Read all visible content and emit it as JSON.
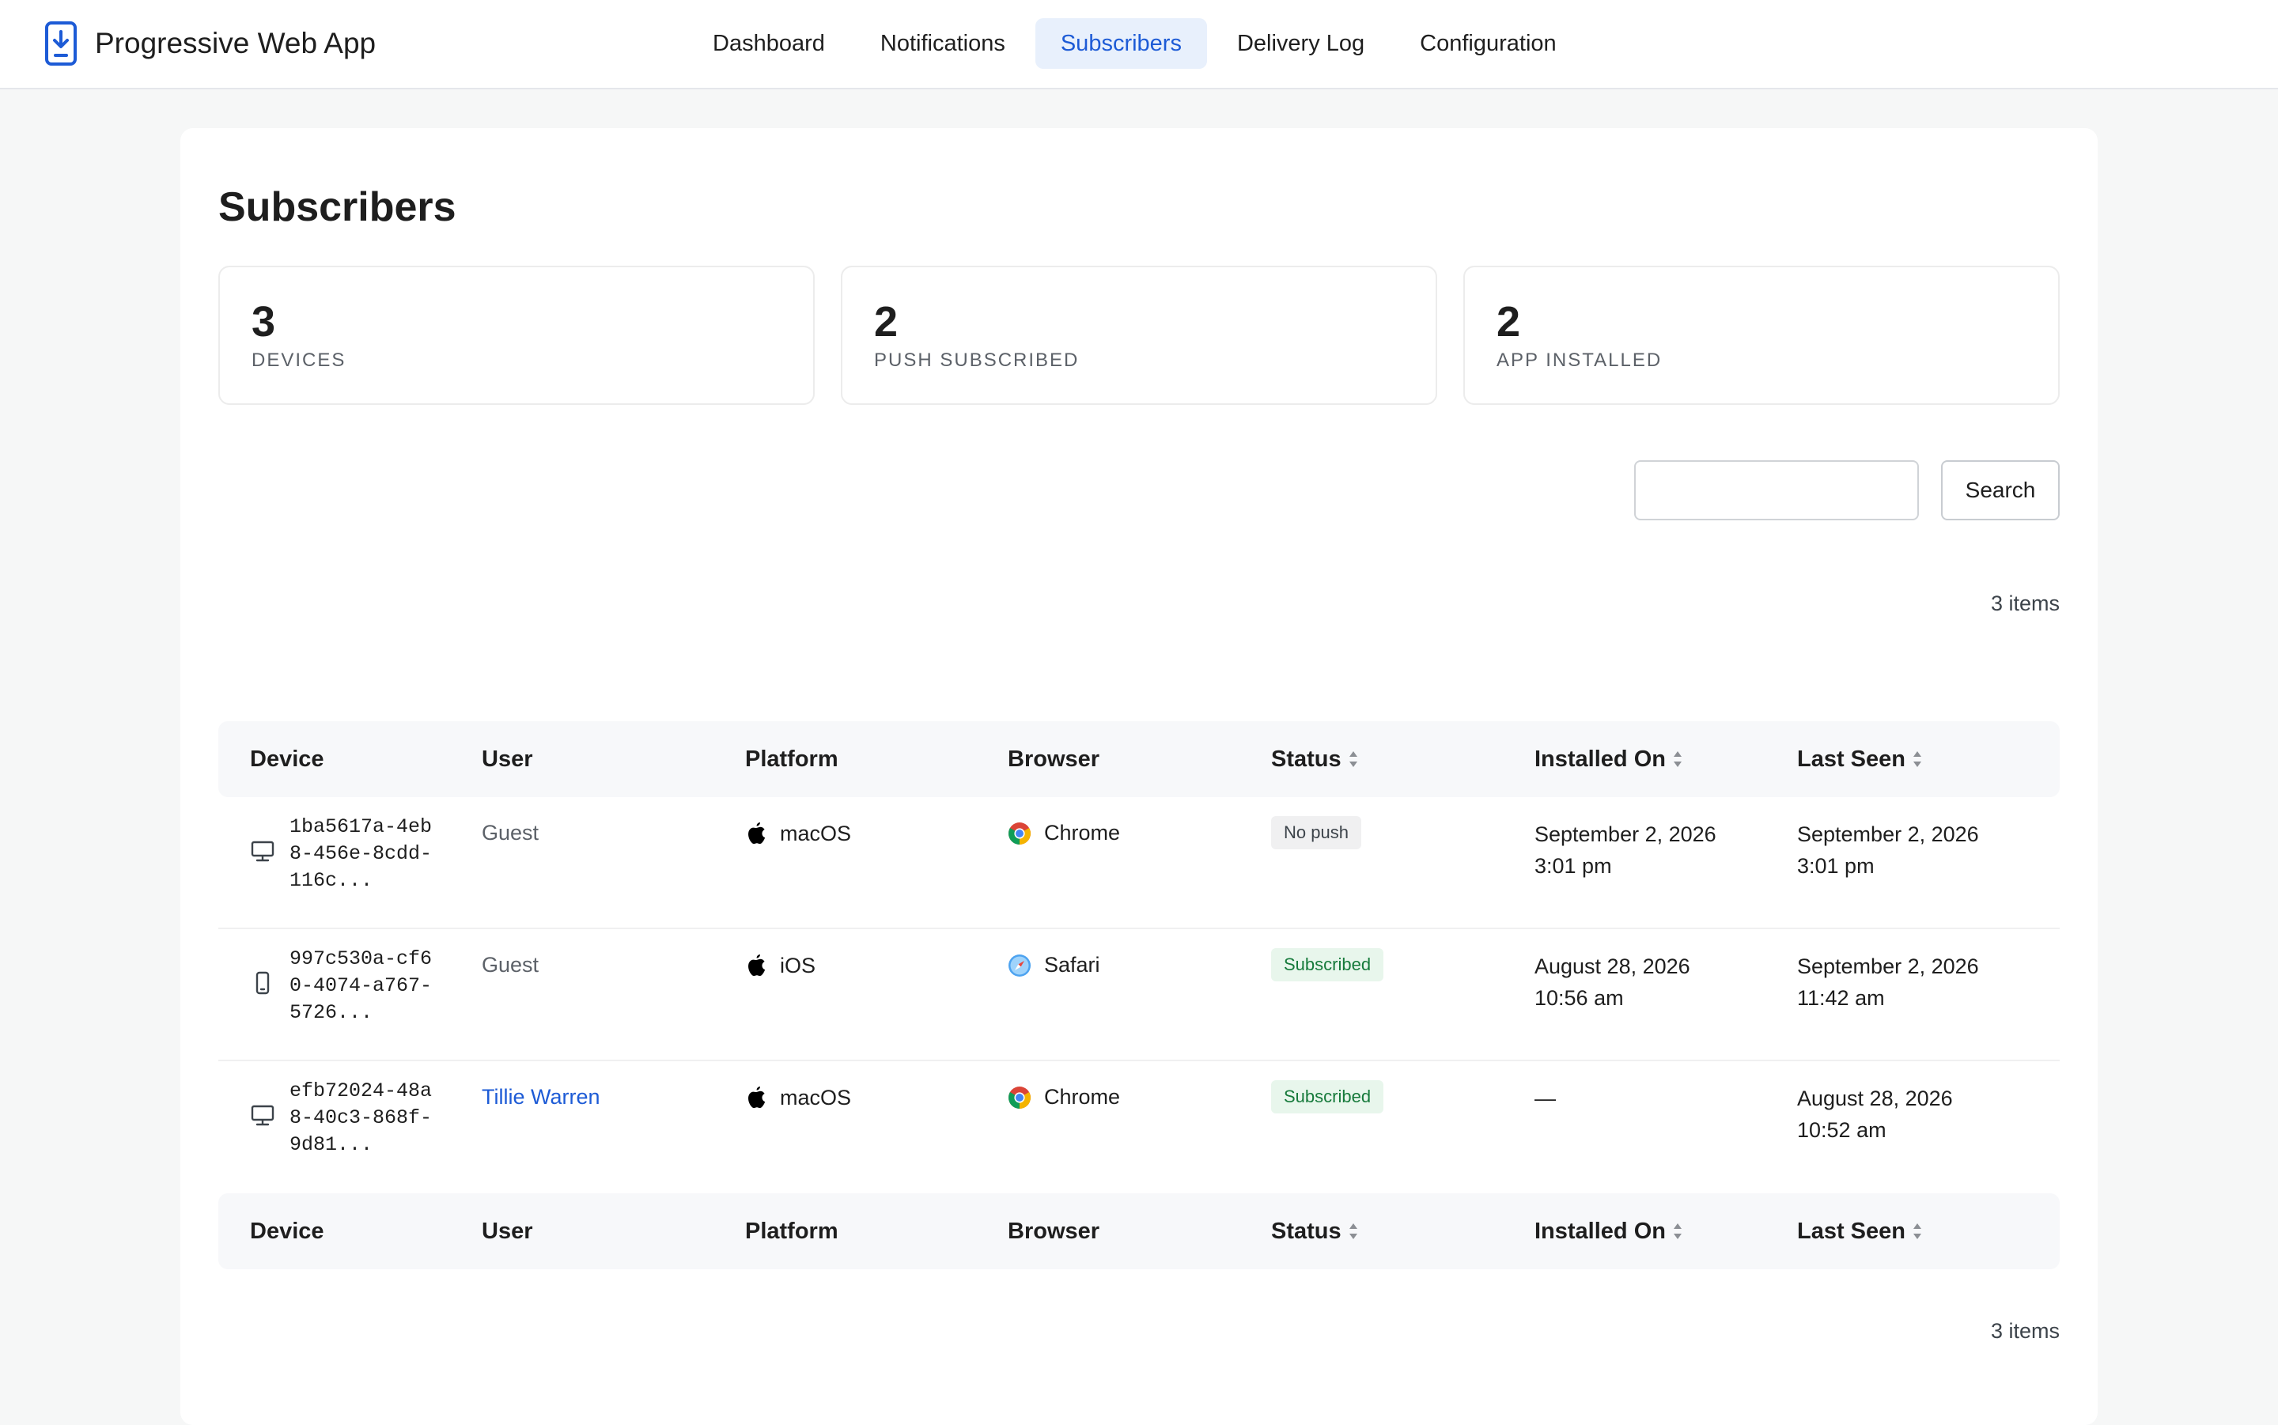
{
  "app": {
    "title": "Progressive Web App"
  },
  "nav": {
    "tabs": [
      {
        "label": "Dashboard",
        "active": false
      },
      {
        "label": "Notifications",
        "active": false
      },
      {
        "label": "Subscribers",
        "active": true
      },
      {
        "label": "Delivery Log",
        "active": false
      },
      {
        "label": "Configuration",
        "active": false
      }
    ]
  },
  "page": {
    "title": "Subscribers"
  },
  "stats": [
    {
      "value": "3",
      "label": "DEVICES"
    },
    {
      "value": "2",
      "label": "PUSH SUBSCRIBED"
    },
    {
      "value": "2",
      "label": "APP INSTALLED"
    }
  ],
  "search": {
    "value": "",
    "button_label": "Search"
  },
  "items_count": "3 items",
  "table": {
    "headers": [
      "Device",
      "User",
      "Platform",
      "Browser",
      "Status",
      "Installed On",
      "Last Seen"
    ],
    "rows": [
      {
        "device_icon": "desktop-icon",
        "device_id": "1ba5617a-4eb8-456e-8cdd-116c...",
        "user": "Guest",
        "user_is_link": false,
        "platform_icon": "apple-icon",
        "platform": "macOS",
        "browser_icon": "chrome-icon",
        "browser": "Chrome",
        "status": "No push",
        "installed_date": "September 2, 2026",
        "installed_time": "3:01 pm",
        "last_date": "September 2, 2026",
        "last_time": "3:01 pm"
      },
      {
        "device_icon": "mobile-icon",
        "device_id": "997c530a-cf60-4074-a767-5726...",
        "user": "Guest",
        "user_is_link": false,
        "platform_icon": "apple-icon",
        "platform": "iOS",
        "browser_icon": "safari-icon",
        "browser": "Safari",
        "status": "Subscribed",
        "installed_date": "August 28, 2026",
        "installed_time": "10:56 am",
        "last_date": "September 2, 2026",
        "last_time": "11:42 am"
      },
      {
        "device_icon": "desktop-icon",
        "device_id": "efb72024-48a8-40c3-868f-9d81...",
        "user": "Tillie Warren",
        "user_is_link": true,
        "platform_icon": "apple-icon",
        "platform": "macOS",
        "browser_icon": "chrome-icon",
        "browser": "Chrome",
        "status": "Subscribed",
        "installed_date": "—",
        "installed_time": "",
        "last_date": "August 28, 2026",
        "last_time": "10:52 am"
      }
    ]
  },
  "colors": {
    "accent": "#1d5bd6",
    "active_tab_bg": "#e8f0fc",
    "subscribed_bg": "#e8f6ec",
    "subscribed_text": "#167a3b",
    "nopush_bg": "#f0f0f1"
  }
}
